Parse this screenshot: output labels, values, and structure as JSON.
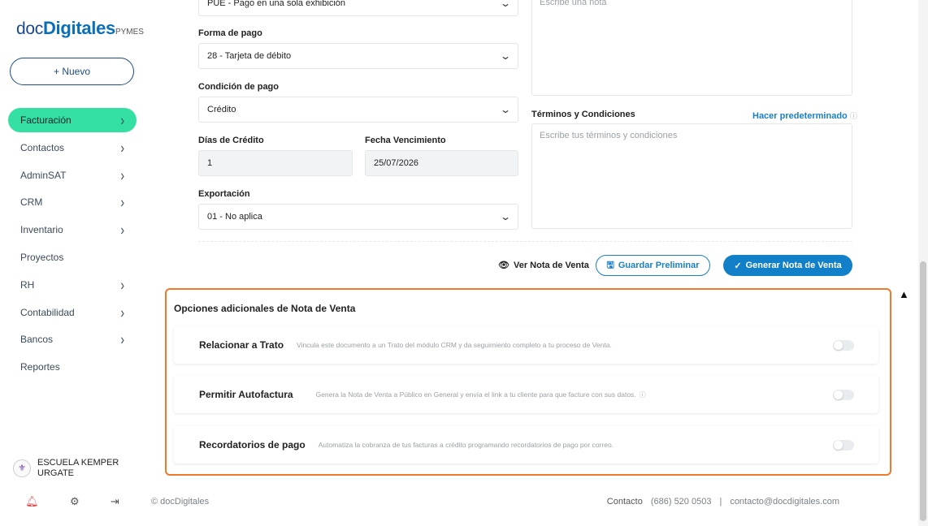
{
  "brand": {
    "prefix": "doc",
    "bold": "Digitales",
    "suffix": "PYMES"
  },
  "new_button": "+ Nuevo",
  "nav": [
    {
      "label": "Facturación",
      "chevron": true,
      "active": true
    },
    {
      "label": "Contactos",
      "chevron": true
    },
    {
      "label": "AdminSAT",
      "chevron": true
    },
    {
      "label": "CRM",
      "chevron": true
    },
    {
      "label": "Inventario",
      "chevron": true
    },
    {
      "label": "Proyectos",
      "chevron": false
    },
    {
      "label": "RH",
      "chevron": true
    },
    {
      "label": "Contabilidad",
      "chevron": true
    },
    {
      "label": "Bancos",
      "chevron": true
    },
    {
      "label": "Reportes",
      "chevron": false
    }
  ],
  "school": {
    "name_line1": "ESCUELA KEMPER",
    "name_line2": "URGATE"
  },
  "bottom_icons": [
    "bell-icon",
    "gear-icon",
    "logout-icon"
  ],
  "form": {
    "metodo_pago_value": "PUE - Pago en una sola exhibición",
    "forma_pago_label": "Forma de pago",
    "forma_pago_value": "28 - Tarjeta de débito",
    "condicion_label": "Condición de pago",
    "condicion_value": "Crédito",
    "dias_label": "Días de Crédito",
    "dias_value": "1",
    "fecha_label": "Fecha Vencimiento",
    "fecha_value": "25/07/2026",
    "exportacion_label": "Exportación",
    "exportacion_value": "01 - No aplica",
    "nota_placeholder": "Escribe una nota",
    "terminos_label": "Términos y Condiciones",
    "hacer_predeterminado": "Hacer predeterminado",
    "terminos_placeholder": "Escribe tus términos y condiciones"
  },
  "actions": {
    "ver": "Ver Nota de Venta",
    "guardar": "Guardar Preliminar",
    "generar": "Generar Nota de Venta"
  },
  "options": {
    "title": "Opciones adicionales de Nota de Venta",
    "items": [
      {
        "title": "Relacionar a Trato",
        "desc": "Vincula este documento a un Trato del módulo CRM y da seguimiento completo a tu proceso de Venta.",
        "enabled": false
      },
      {
        "title": "Permitir Autofactura",
        "desc": "Genera la Nota de Venta a Público en General y envía el link a tu cliente para que facture con sus datos.",
        "enabled": false
      },
      {
        "title": "Recordatorios de pago",
        "desc": "Automatiza la cobranza de tus facturas a crédito programando recordatorios de pago por correo.",
        "enabled": false
      }
    ]
  },
  "footer": {
    "copyright": "© docDigitales",
    "contacto": "Contacto",
    "phone": "(686) 520 0503",
    "sep": "|",
    "email": "contacto@docdigitales.com"
  },
  "colors": {
    "accent": "#33e0a1",
    "primary": "#1280c8",
    "highlight": "#ee7a2a"
  }
}
